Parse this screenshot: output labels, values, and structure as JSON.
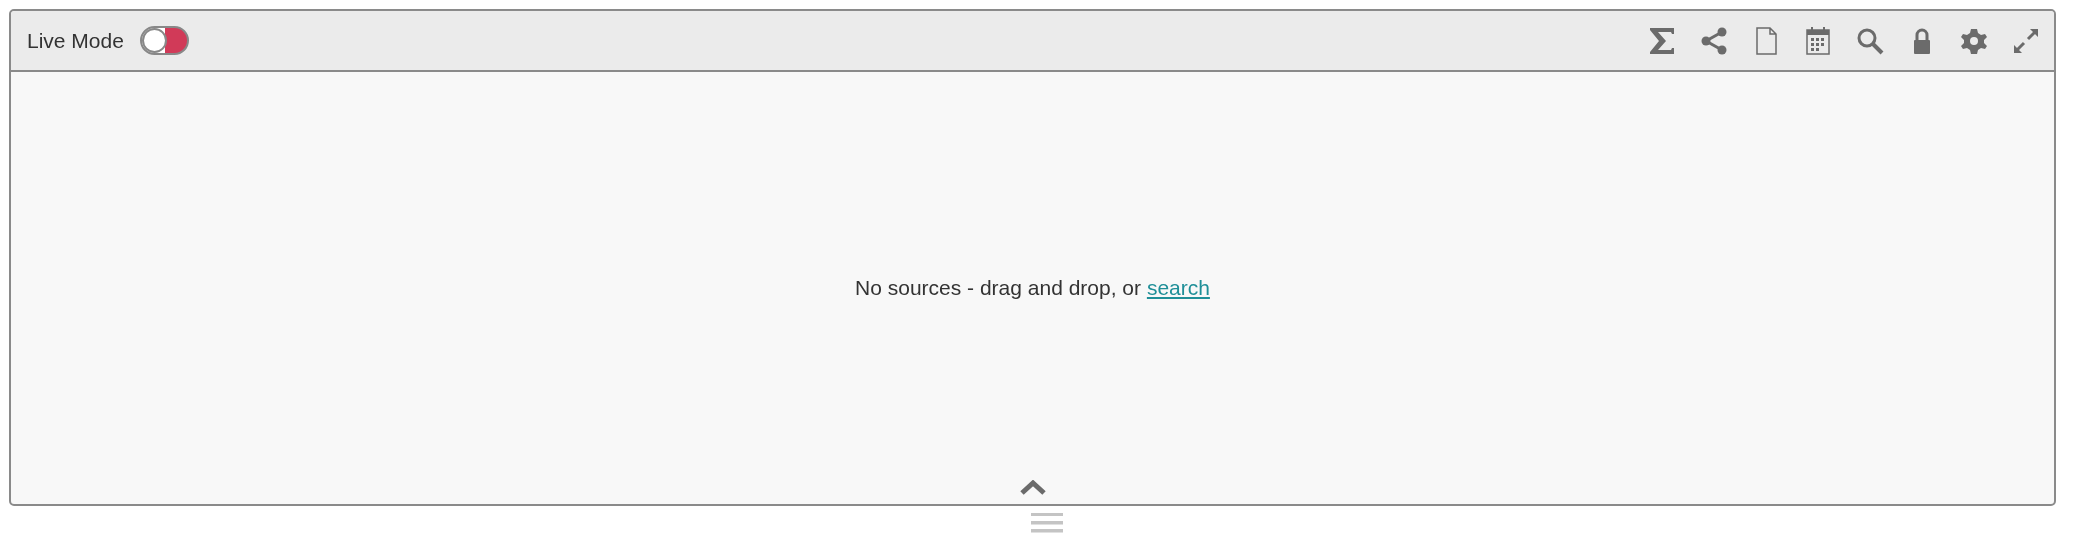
{
  "header": {
    "label": "Live Mode",
    "live_toggle": {
      "on": false
    }
  },
  "toolbar": [
    {
      "kind": "sum"
    },
    {
      "kind": "share"
    },
    {
      "kind": "document"
    },
    {
      "kind": "calendar"
    },
    {
      "kind": "search"
    },
    {
      "kind": "lock"
    },
    {
      "kind": "settings"
    },
    {
      "kind": "expand"
    }
  ],
  "empty_message": {
    "text": "No sources - drag and drop, or",
    "link": "search"
  }
}
